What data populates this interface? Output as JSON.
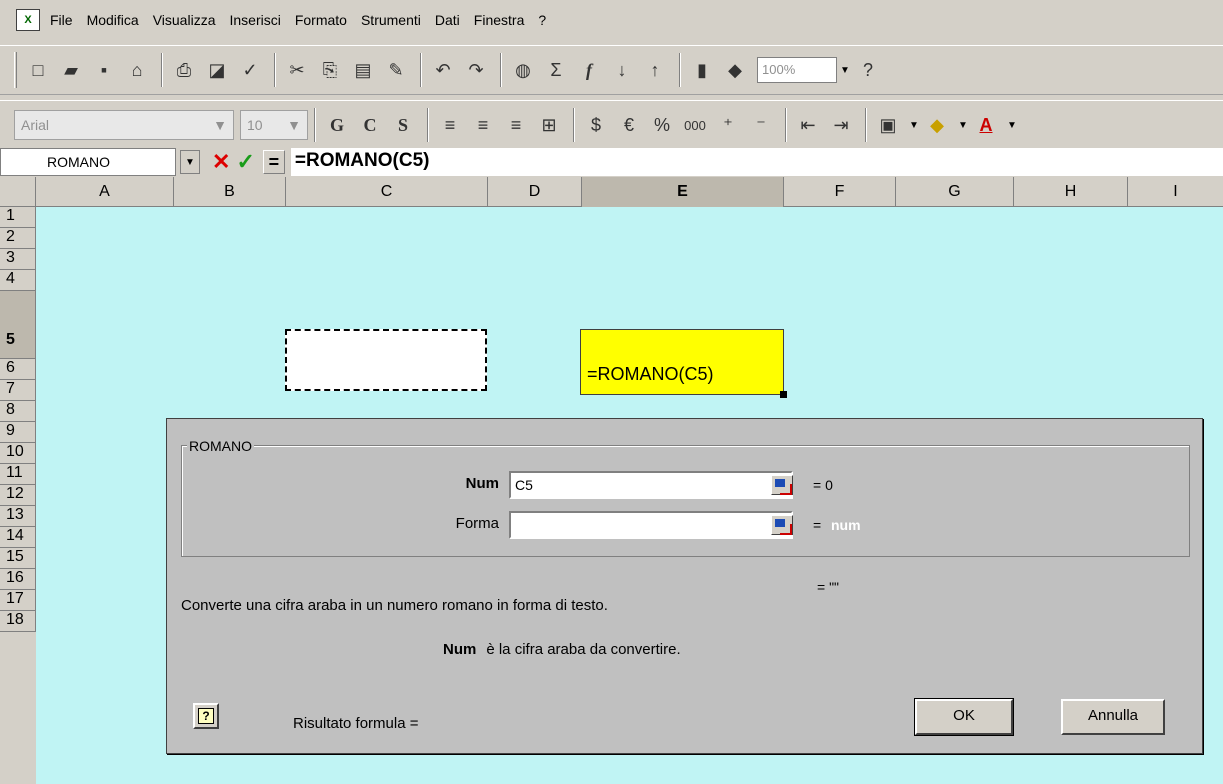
{
  "menu": {
    "app_icon": "excel-icon",
    "items": [
      "File",
      "Modifica",
      "Visualizza",
      "Inserisci",
      "Formato",
      "Strumenti",
      "Dati",
      "Finestra",
      "?"
    ]
  },
  "toolbar": {
    "zoom": "100%",
    "font_name": "Arial",
    "font_size": "10",
    "bold_label": "G",
    "italic_label": "C",
    "underline_label": "S",
    "currency": "€",
    "percent": "%",
    "thousands": "000",
    "font_color_label": "A"
  },
  "formula_bar": {
    "name_box": "ROMANO",
    "equals": "=",
    "formula": "=ROMANO(C5)"
  },
  "columns": [
    {
      "label": "A",
      "selected": false
    },
    {
      "label": "B",
      "selected": false
    },
    {
      "label": "C",
      "selected": false
    },
    {
      "label": "D",
      "selected": false
    },
    {
      "label": "E",
      "selected": true
    },
    {
      "label": "F",
      "selected": false
    },
    {
      "label": "G",
      "selected": false
    },
    {
      "label": "H",
      "selected": false
    },
    {
      "label": "I",
      "selected": false
    }
  ],
  "rows": [
    "1",
    "2",
    "3",
    "4",
    "5",
    "6",
    "7",
    "8",
    "9",
    "10",
    "11",
    "12",
    "13",
    "14",
    "15",
    "16",
    "17",
    "18"
  ],
  "selected_row": "5",
  "cells": {
    "e5": "=ROMANO(C5)"
  },
  "colors": {
    "sheet_bg": "#c0f4f4",
    "active_cell_bg": "#ffff00"
  },
  "dialog": {
    "group_title": "ROMANO",
    "args": [
      {
        "label": "Num",
        "value": "C5",
        "result": "= 0"
      },
      {
        "label": "Forma",
        "value": "",
        "result_eq": "=",
        "result_hint": "num"
      }
    ],
    "result_preview": "= \"\"",
    "description": "Converte una cifra araba in un numero romano in forma di testo.",
    "arg_desc_name": "Num",
    "arg_desc_text": "è la cifra araba da convertire.",
    "help_label": "?",
    "result_label": "Risultato formula =",
    "ok_label": "OK",
    "cancel_label": "Annulla"
  }
}
